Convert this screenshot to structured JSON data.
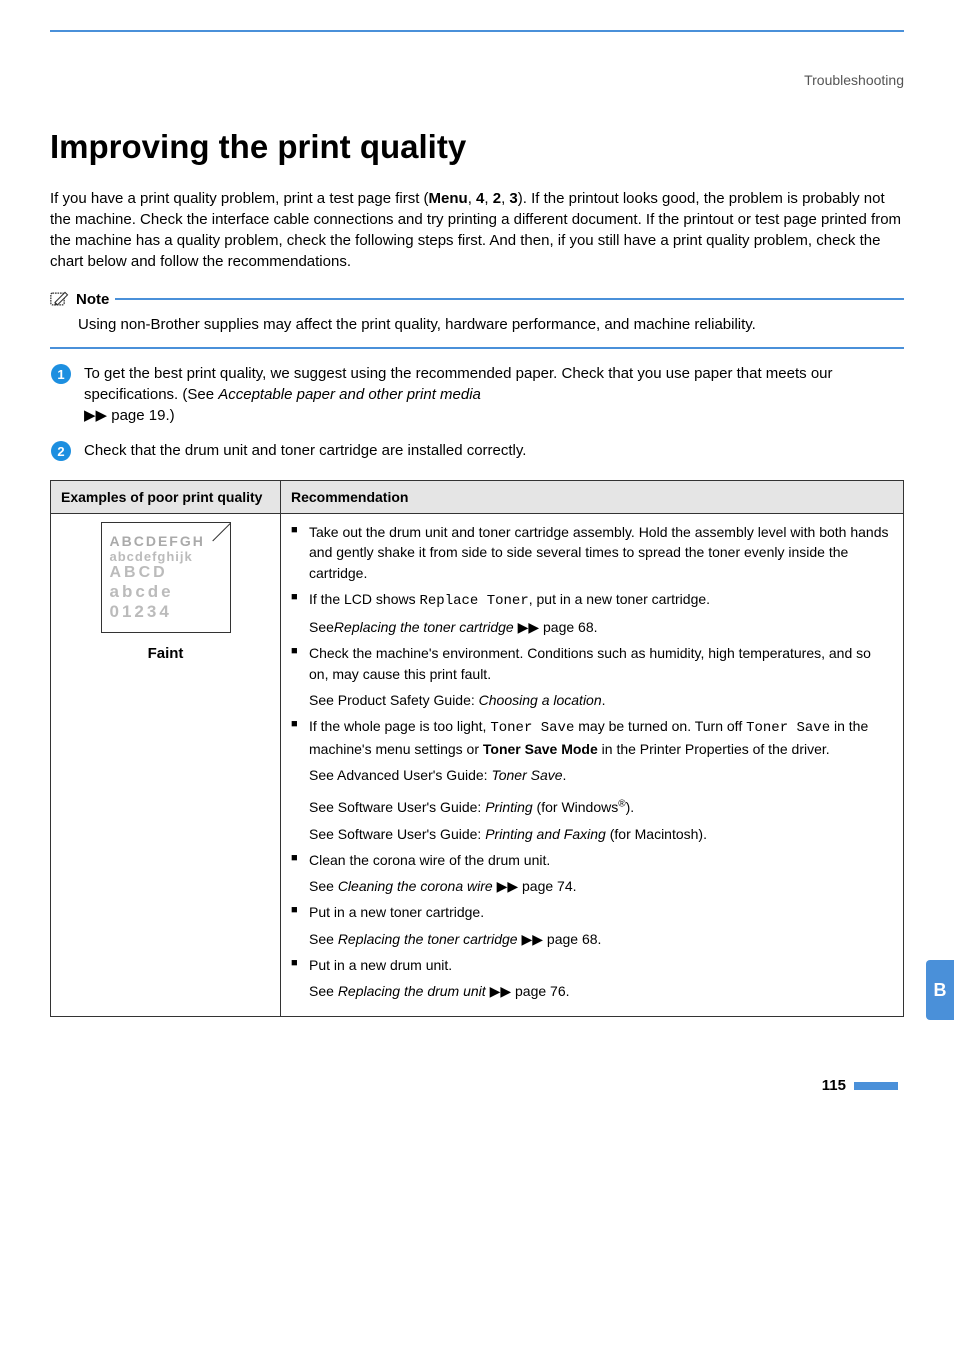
{
  "breadcrumb": "Troubleshooting",
  "heading": "Improving the print quality",
  "intro_parts": {
    "p1": "If you have a print quality problem, print a test page first (",
    "menu": "Menu",
    "p2": ", ",
    "k1": "4",
    "k2": "2",
    "k3": "3",
    "p3": "). If the printout looks good, the problem is probably not the machine. Check the interface cable connections and try printing a different document. If the printout or test page printed from the machine has a quality problem, check the following steps first. And then, if you still have a print quality problem, check the chart below and follow the recommendations."
  },
  "note": {
    "title": "Note",
    "body": "Using non-Brother supplies may affect the print quality, hardware performance, and machine reliability."
  },
  "steps": [
    {
      "pre": "To get the best print quality, we suggest using the recommended paper. Check that you use paper that meets our specifications. (See ",
      "ref_italic": "Acceptable paper and other print media",
      "post": " ",
      "arrows": "▶▶",
      "page": " page 19.)"
    },
    {
      "pre": "Check that the drum unit and toner cartridge are installed correctly.",
      "ref_italic": "",
      "post": "",
      "arrows": "",
      "page": ""
    }
  ],
  "table": {
    "header_left": "Examples of poor print quality",
    "header_right": "Recommendation",
    "example": {
      "l1": "ABCDEFGH",
      "l2": "abcdefghijk",
      "l3": "ABCD",
      "l4": "abcde",
      "l5": "01234",
      "label": "Faint"
    },
    "recs": [
      {
        "type": "bullet",
        "text": "Take out the drum unit and toner cartridge assembly. Hold the assembly level with both hands and gently shake it from side to side several times to spread the toner evenly inside the cartridge."
      },
      {
        "type": "bullet",
        "html": true,
        "pre": "If the LCD shows ",
        "mono": "Replace Toner",
        "post": ", put in a new toner cartridge."
      },
      {
        "type": "sub",
        "html": true,
        "pre": "See",
        "italic": "Replacing the toner cartridge",
        "arrows": " ▶▶ ",
        "post": "page 68."
      },
      {
        "type": "bullet",
        "text": "Check the machine's environment. Conditions such as humidity, high temperatures, and so on, may cause this print fault."
      },
      {
        "type": "sub",
        "html": true,
        "pre": "See Product Safety Guide: ",
        "italic": "Choosing a location",
        "post": "."
      },
      {
        "type": "bullet",
        "html": true,
        "pre": "If the whole page is too light, ",
        "mono": "Toner Save",
        "mid": " may be turned on. Turn off ",
        "mono2": "Toner Save",
        "post2": " in the machine's menu settings or ",
        "bold": "Toner Save Mode",
        "post3": " in the Printer Properties of the driver."
      },
      {
        "type": "sub",
        "html": true,
        "pre": "See Advanced User's Guide: ",
        "italic": "Toner Save",
        "post": "."
      },
      {
        "type": "sub",
        "html": true,
        "pre": "See Software User's Guide: ",
        "italic": "Printing",
        "post": " (for Windows",
        "sup": "®",
        "post2": ")."
      },
      {
        "type": "sub",
        "html": true,
        "pre": "See Software User's Guide: ",
        "italic": "Printing and Faxing",
        "post": " (for Macintosh)."
      },
      {
        "type": "bullet",
        "text": "Clean the corona wire of the drum unit."
      },
      {
        "type": "sub",
        "html": true,
        "pre": "See ",
        "italic": "Cleaning the corona wire",
        "arrows": " ▶▶ ",
        "post": "page 74."
      },
      {
        "type": "bullet",
        "text": "Put in a new toner cartridge."
      },
      {
        "type": "sub",
        "html": true,
        "pre": "See ",
        "italic": "Replacing the toner cartridge",
        "arrows": " ▶▶ ",
        "post": "page 68."
      },
      {
        "type": "bullet",
        "text": "Put in a new drum unit."
      },
      {
        "type": "sub",
        "html": true,
        "pre": "See ",
        "italic": "Replacing the drum unit",
        "arrows": " ▶▶ ",
        "post": "page 76."
      }
    ]
  },
  "appendix_tab": "B",
  "page_number": "115"
}
